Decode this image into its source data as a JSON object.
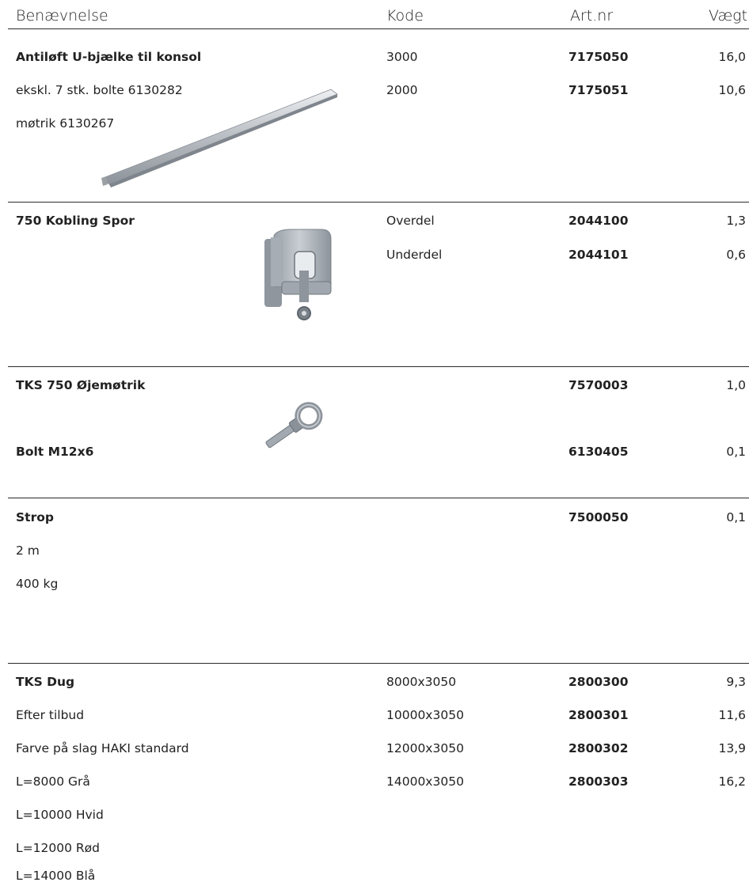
{
  "header": {
    "name": "Benævnelse",
    "code": "Kode",
    "art": "Art.nr",
    "weight": "Vægt"
  },
  "sections": [
    {
      "title": "Antiløft U-bjælke til konsol",
      "notes": [
        "ekskl. 7 stk. bolte 6130282",
        "møtrik 6130267"
      ],
      "rows": [
        {
          "code": "3000",
          "art": "7175050",
          "weight": "16,0"
        },
        {
          "code": "2000",
          "art": "7175051",
          "weight": "10,6"
        }
      ],
      "image": "u-beam"
    },
    {
      "title": "750 Kobling Spor",
      "rows": [
        {
          "code": "Overdel",
          "art": "2044100",
          "weight": "1,3"
        },
        {
          "code": "Underdel",
          "art": "2044101",
          "weight": "0,6"
        }
      ],
      "image": "rail-coupling"
    },
    {
      "title": "TKS 750 Øjemøtrik",
      "title2": "Bolt M12x6",
      "rows": [
        {
          "code": "",
          "art": "7570003",
          "weight": "1,0"
        },
        {
          "code": "",
          "art": "6130405",
          "weight": "0,1"
        }
      ],
      "image": "eye-nut-bolt"
    },
    {
      "title": "Strop",
      "notes": [
        "2 m",
        "400 kg"
      ],
      "rows": [
        {
          "code": "",
          "art": "7500050",
          "weight": "0,1"
        }
      ]
    },
    {
      "title": "TKS Dug",
      "notes": [
        "Efter tilbud",
        "Farve på slag HAKI standard",
        "L=8000 Grå",
        "L=10000 Hvid",
        "L=12000 Rød",
        "L=14000 Blå"
      ],
      "rows": [
        {
          "code": "8000x3050",
          "art": "2800300",
          "weight": "9,3"
        },
        {
          "code": "10000x3050",
          "art": "2800301",
          "weight": "11,6"
        },
        {
          "code": "12000x3050",
          "art": "2800302",
          "weight": "13,9"
        },
        {
          "code": "14000x3050",
          "art": "2800303",
          "weight": "16,2"
        }
      ]
    }
  ]
}
